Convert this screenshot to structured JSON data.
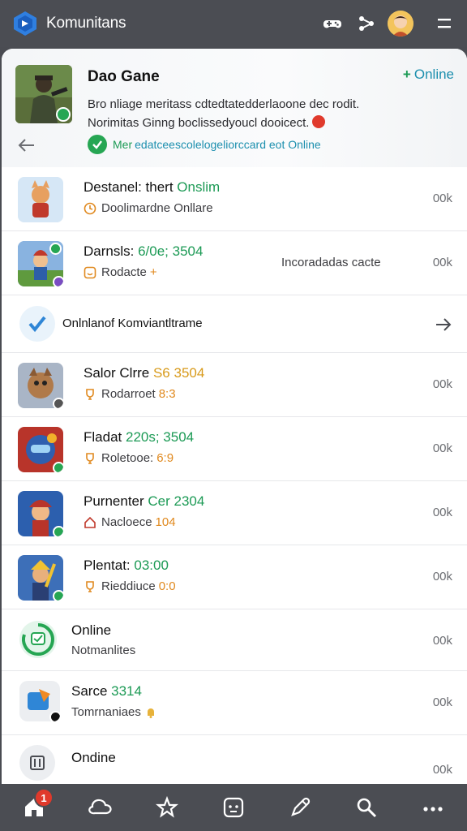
{
  "app": {
    "title": "Komunitans"
  },
  "hero": {
    "title": "Dao Gane",
    "online_label": "Online",
    "description_line1": "Bro nliage meritass cdtedtatedderlaoone dec rodit.",
    "description_line2": "Norimitas Ginng boclissedyoucl dooicect.",
    "status_green": "Mer",
    "status_text": "edatceescolelogeliorccard eot Online"
  },
  "rows": [
    {
      "title": "Destanel: thert ",
      "title_hl": "Onslim",
      "sub": "Doolimardne Onllare",
      "sub_num": "",
      "mid": "",
      "value": "00k"
    },
    {
      "title": "Darnsls: ",
      "title_hl": "6/0e; 3504",
      "sub": "Rodacte",
      "sub_num": "+",
      "mid": "Incoradadas cacte",
      "value": "00k"
    },
    {
      "title": "Onlnlanof Komviantltrame"
    },
    {
      "title": "Salor Clrre ",
      "title_hl": "S6 3504",
      "sub": "Rodarroet",
      "sub_num": "8:3",
      "value": "00k"
    },
    {
      "title": "Fladat ",
      "title_hl": "220s; 3504",
      "sub": "Roletooe:",
      "sub_num": "6:9",
      "value": "00k"
    },
    {
      "title": "Purnenter ",
      "title_hl": "Cer 2304",
      "sub": "Nacloece",
      "sub_num": "104",
      "value": "00k"
    },
    {
      "title": "Plentat: ",
      "title_hl": "03:00",
      "sub": "Rieddiuce",
      "sub_num": "0:0",
      "value": "00k"
    },
    {
      "title": "Online",
      "sub": "Notmanlites",
      "value": "00k"
    },
    {
      "title": "Sarce ",
      "title_hl": "3314",
      "sub": "Tomrnaniaes",
      "value": "00k"
    },
    {
      "title": "Ondine",
      "value": "00k"
    }
  ],
  "bottom_nav": {
    "notification_count": "1"
  },
  "colors": {
    "accent_green": "#1c9a55",
    "accent_blue": "#1c8fae",
    "bar": "#4b4d53",
    "alert": "#e0392b"
  }
}
